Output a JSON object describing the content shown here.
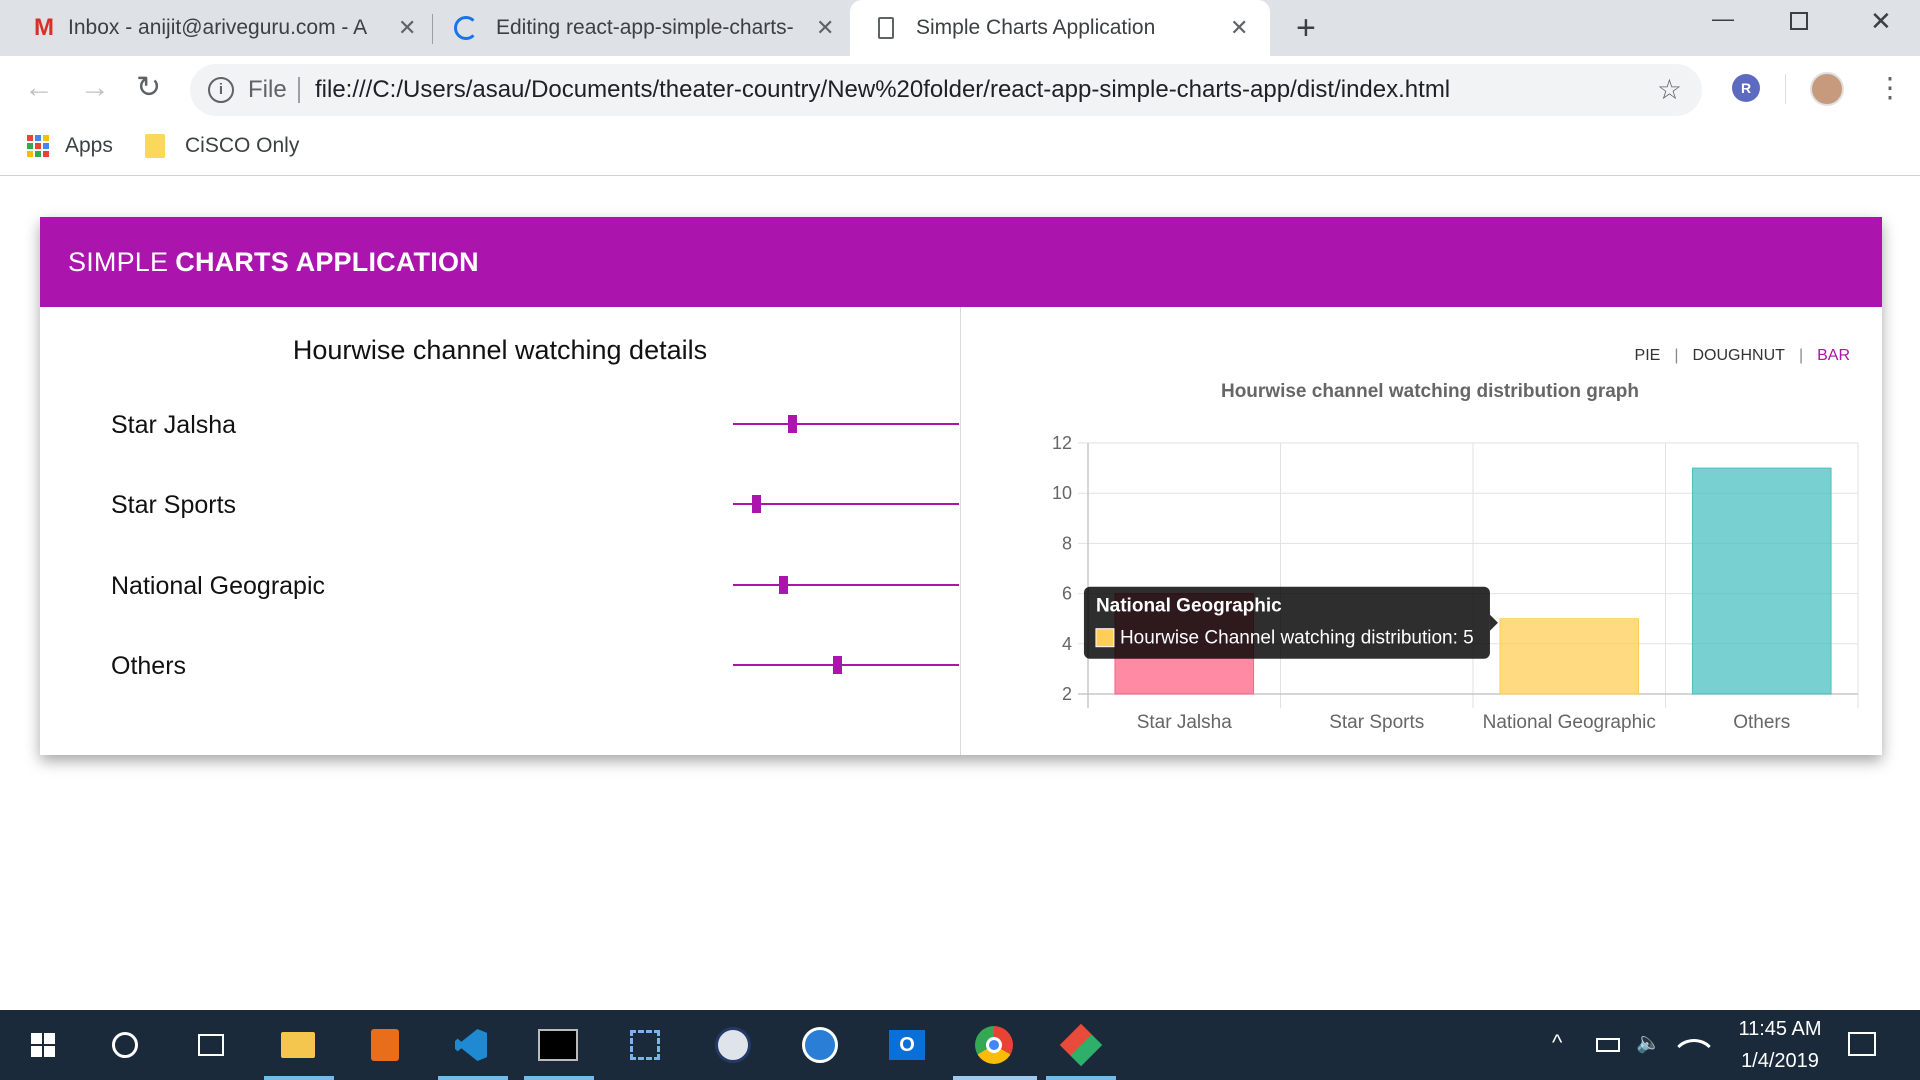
{
  "browser": {
    "tabs": [
      {
        "title": "Inbox - anijit@ariveguru.com - A",
        "icon": "gmail-icon"
      },
      {
        "title": "Editing react-app-simple-charts-",
        "icon": "loading-icon"
      },
      {
        "title": "Simple Charts Application",
        "icon": "page-icon"
      }
    ],
    "address": {
      "scheme_label": "File",
      "url": "file:///C:/Users/asau/Documents/theater-country/New%20folder/react-app-simple-charts-app/dist/index.html"
    },
    "extension_letter": "R",
    "bookmarks": [
      {
        "label": "Apps",
        "icon": "apps-grid-icon"
      },
      {
        "label": "CiSCO Only",
        "icon": "folder-icon"
      }
    ]
  },
  "app": {
    "header_light": "SIMPLE",
    "header_bold": "CHARTS APPLICATION",
    "accent": "#ab15ad",
    "left_title": "Hourwise channel watching details",
    "sliders": [
      {
        "label": "Star Jalsha",
        "value": 0.26
      },
      {
        "label": "Star Sports",
        "value": 0.1
      },
      {
        "label": "National Geograpic",
        "value": 0.22
      },
      {
        "label": "Others",
        "value": 0.46
      }
    ],
    "chart_tabs": {
      "pie": "PIE",
      "doughnut": "DOUGHNUT",
      "bar": "BAR",
      "active": "BAR"
    }
  },
  "chart_data": {
    "type": "bar",
    "title": "Hourwise channel watching distribution graph",
    "categories": [
      "Star Jalsha",
      "Star Sports",
      "National Geographic",
      "Others"
    ],
    "series": [
      {
        "name": "Hourwise Channel watching distribution",
        "values": [
          6,
          2,
          5,
          11
        ]
      }
    ],
    "colors": [
      "#ff6384",
      "#36a2eb",
      "#ffce56",
      "#4bc0c0"
    ],
    "ylim": [
      2,
      12
    ],
    "yticks": [
      2,
      4,
      6,
      8,
      10,
      12
    ],
    "grid": true,
    "tooltip": {
      "title": "National Geographic",
      "label": "Hourwise Channel watching distribution: 5",
      "category_index": 2
    }
  },
  "taskbar": {
    "time": "11:45 AM",
    "date": "1/4/2019",
    "icons": [
      "windows-start-icon",
      "cortana-icon",
      "task-view-icon",
      "file-explorer-icon",
      "office-icon",
      "vscode-icon",
      "terminal-icon",
      "network-icon",
      "lock-icon",
      "messenger-icon",
      "outlook-icon",
      "chrome-icon",
      "git-icon"
    ]
  }
}
